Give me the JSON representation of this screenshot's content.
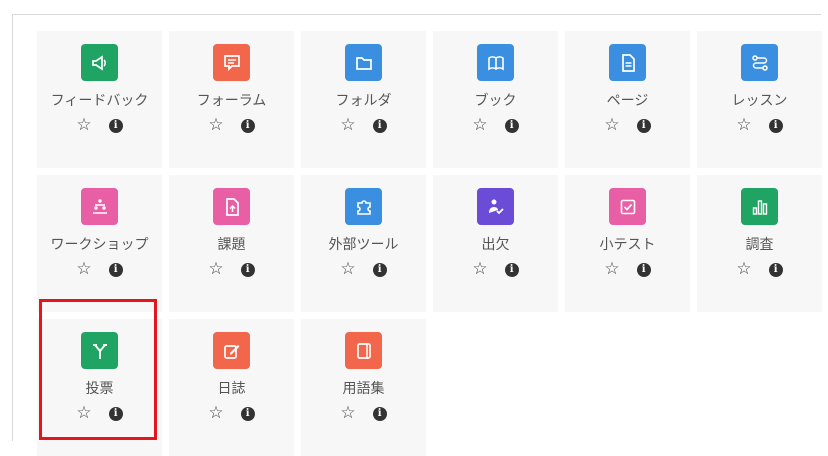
{
  "activities": [
    {
      "label": "フィードバック",
      "icon": "megaphone-icon",
      "color": "#20a464"
    },
    {
      "label": "フォーラム",
      "icon": "forum-icon",
      "color": "#f2664c"
    },
    {
      "label": "フォルダ",
      "icon": "folder-icon",
      "color": "#3b8fe0"
    },
    {
      "label": "ブック",
      "icon": "book-icon",
      "color": "#3b8fe0"
    },
    {
      "label": "ページ",
      "icon": "page-icon",
      "color": "#3b8fe0"
    },
    {
      "label": "レッスン",
      "icon": "lesson-icon",
      "color": "#3b8fe0"
    },
    {
      "label": "ワークショップ",
      "icon": "workshop-icon",
      "color": "#e85fa6"
    },
    {
      "label": "課題",
      "icon": "assignment-icon",
      "color": "#e85fa6"
    },
    {
      "label": "外部ツール",
      "icon": "puzzle-icon",
      "color": "#3b8fe0"
    },
    {
      "label": "出欠",
      "icon": "attendance-icon",
      "color": "#6a4cd6"
    },
    {
      "label": "小テスト",
      "icon": "quiz-icon",
      "color": "#e85fa6"
    },
    {
      "label": "調査",
      "icon": "survey-chart-icon",
      "color": "#20a464"
    },
    {
      "label": "投票",
      "icon": "choice-icon",
      "color": "#20a464"
    },
    {
      "label": "日誌",
      "icon": "journal-icon",
      "color": "#f2664c"
    },
    {
      "label": "用語集",
      "icon": "glossary-icon",
      "color": "#f2664c"
    }
  ],
  "action_icons": {
    "star": "☆",
    "info": "i"
  },
  "highlight": {
    "target": "投票",
    "color": "#e5151d"
  }
}
